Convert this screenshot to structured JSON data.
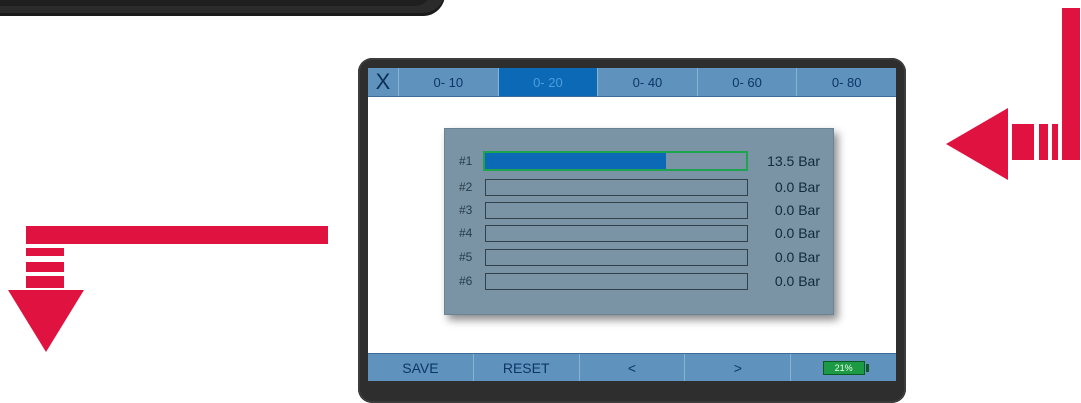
{
  "header": {
    "close_label": "X",
    "tabs": [
      {
        "label": "0- 10"
      },
      {
        "label": "0- 20"
      },
      {
        "label": "0- 40"
      },
      {
        "label": "0- 60"
      },
      {
        "label": "0- 80"
      }
    ],
    "active_tab": "0- 20"
  },
  "channels": [
    {
      "label": "#1",
      "value": "13.5 Bar",
      "fill_fraction": 0.695,
      "selected": true
    },
    {
      "label": "#2",
      "value": "0.0 Bar",
      "fill_fraction": 0
    },
    {
      "label": "#3",
      "value": "0.0 Bar",
      "fill_fraction": 0
    },
    {
      "label": "#4",
      "value": "0.0 Bar",
      "fill_fraction": 0
    },
    {
      "label": "#5",
      "value": "0.0 Bar",
      "fill_fraction": 0
    },
    {
      "label": "#6",
      "value": "0.0 Bar",
      "fill_fraction": 0
    }
  ],
  "footer": {
    "save_label": "SAVE",
    "reset_label": "RESET",
    "prev_label": "<",
    "next_label": ">",
    "battery_label": "21%",
    "battery_level": 0.21
  },
  "colors": {
    "accent_blue": "#0b69b5",
    "bar_blue": "#5f93be",
    "panel_gray": "#7b94a5",
    "select_green": "#1ca54e",
    "arrow_red": "#e0123f"
  }
}
